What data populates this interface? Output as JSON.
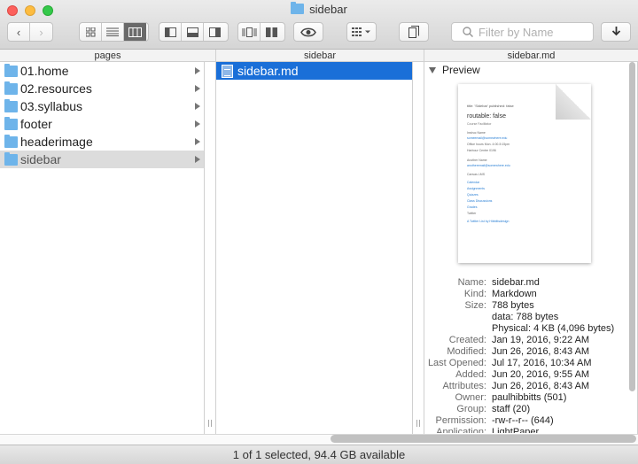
{
  "window": {
    "title": "sidebar"
  },
  "toolbar": {
    "search_placeholder": "Filter by Name",
    "icons": [
      "chevron-left-icon",
      "chevron-right-icon",
      "icon-view-icon",
      "list-view-icon",
      "column-view-icon",
      "left-pane-icon",
      "bottom-pane-icon",
      "right-pane-icon",
      "coverflow-icon",
      "dual-pane-icon",
      "quicklook-eye-icon",
      "arrange-grid-icon",
      "copy-path-icon",
      "download-arrow-icon"
    ]
  },
  "columns": {
    "headers": [
      "pages",
      "sidebar",
      "sidebar.md"
    ]
  },
  "pages": {
    "items": [
      {
        "label": "01.home"
      },
      {
        "label": "02.resources"
      },
      {
        "label": "03.syllabus"
      },
      {
        "label": "footer"
      },
      {
        "label": "headerimage"
      },
      {
        "label": "sidebar"
      }
    ]
  },
  "sidebar_col": {
    "items": [
      {
        "label": "sidebar.md"
      }
    ]
  },
  "preview": {
    "heading": "Preview",
    "doc_lines": {
      "l1": "title: 'Sidebar' published: false",
      "l2": "routable: false",
      "l3": "Course Facilitator",
      "l4": "Instruc Name",
      "l5": "someemail@somewhere.edu",
      "l6": "Office hours Mon. 4:00-5:15pm",
      "l7": "Harbour Centre 0196",
      "l8": "Another Name",
      "l9": "anotheremail@somewhere.edu",
      "l10": "Canvas LMS",
      "l11": "Calendar",
      "l12": "Assignments",
      "l13": "Quizzes",
      "l14": "Class Discussions",
      "l15": "Grades",
      "l16": "Twitter",
      "l17": "A Twitter List by Hibbittsdesign"
    }
  },
  "info": [
    {
      "label": "Name:",
      "value": "sidebar.md"
    },
    {
      "label": "Kind:",
      "value": "Markdown"
    },
    {
      "label": "Size:",
      "value": "788 bytes"
    },
    {
      "label": "",
      "value": "data: 788 bytes"
    },
    {
      "label": "",
      "value": "Physical: 4 KB (4,096 bytes)"
    },
    {
      "label": "Created:",
      "value": "Jan 19, 2016, 9:22 AM"
    },
    {
      "label": "Modified:",
      "value": "Jun 26, 2016, 8:43 AM"
    },
    {
      "label": "Last Opened:",
      "value": "Jul 17, 2016, 10:34 AM"
    },
    {
      "label": "Added:",
      "value": "Jun 20, 2016, 9:55 AM"
    },
    {
      "label": "Attributes:",
      "value": "Jun 26, 2016, 8:43 AM"
    },
    {
      "label": "Owner:",
      "value": "paulhibbitts (501)"
    },
    {
      "label": "Group:",
      "value": "staff (20)"
    },
    {
      "label": "Permission:",
      "value": "-rw-r--r-- (644)"
    },
    {
      "label": "Application:",
      "value": "LightPaper"
    }
  ],
  "status": {
    "text": "1 of 1 selected, 94.4 GB available"
  },
  "colors": {
    "selection_blue": "#1a6fd8",
    "folder_blue": "#6eb4ea",
    "accent_link": "#2a7fd4"
  }
}
